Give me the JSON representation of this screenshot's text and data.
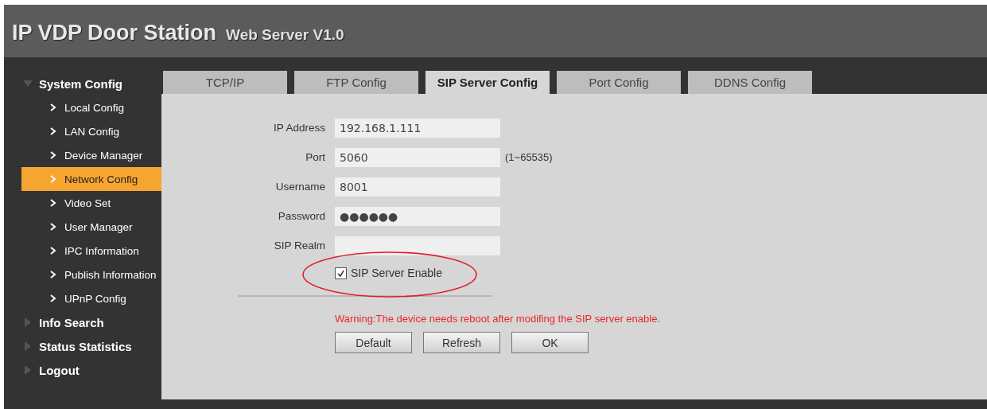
{
  "header": {
    "title": "IP VDP Door Station",
    "subtitle": "Web Server V1.0"
  },
  "sidebar": {
    "groups": [
      {
        "label": "System Config",
        "expanded": true,
        "items": [
          {
            "label": "Local Config",
            "selected": false
          },
          {
            "label": "LAN Config",
            "selected": false
          },
          {
            "label": "Device Manager",
            "selected": false
          },
          {
            "label": "Network Config",
            "selected": true
          },
          {
            "label": "Video Set",
            "selected": false
          },
          {
            "label": "User Manager",
            "selected": false
          },
          {
            "label": "IPC Information",
            "selected": false
          },
          {
            "label": "Publish Information",
            "selected": false
          },
          {
            "label": "UPnP Config",
            "selected": false
          }
        ]
      },
      {
        "label": "Info Search",
        "expanded": false
      },
      {
        "label": "Status Statistics",
        "expanded": false
      },
      {
        "label": "Logout",
        "expanded": false
      }
    ]
  },
  "tabs": [
    {
      "label": "TCP/IP",
      "selected": false
    },
    {
      "label": "FTP Config",
      "selected": false
    },
    {
      "label": "SIP Server Config",
      "selected": true
    },
    {
      "label": "Port Config",
      "selected": false
    },
    {
      "label": "DDNS Config",
      "selected": false
    }
  ],
  "form": {
    "fields": [
      {
        "label": "IP Address",
        "value": "192.168.1.111"
      },
      {
        "label": "Port",
        "value": "5060",
        "hint": "(1~65535)"
      },
      {
        "label": "Username",
        "value": "8001"
      },
      {
        "label": "Password",
        "value": "●●●●●●"
      },
      {
        "label": "SIP Realm"
      }
    ],
    "enable": {
      "label": "SIP Server Enable",
      "checked": true,
      "highlighted": true
    },
    "warning": "Warning:The device needs reboot after modifing the SIP server enable.",
    "buttons": [
      "Default",
      "Refresh",
      "OK"
    ]
  }
}
